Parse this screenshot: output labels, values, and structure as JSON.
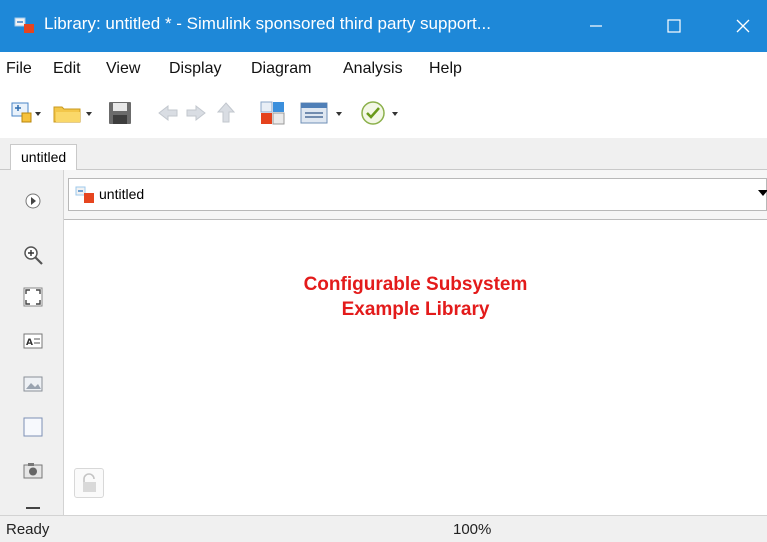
{
  "window": {
    "title": "Library: untitled * - Simulink sponsored third party support...",
    "accent_color": "#1e88d8"
  },
  "menu": [
    "File",
    "Edit",
    "View",
    "Display",
    "Diagram",
    "Analysis",
    "Help"
  ],
  "toolbar": {
    "icons": [
      "new-model-icon",
      "open-folder-icon",
      "save-icon",
      "back-icon",
      "forward-icon",
      "up-icon",
      "library-browser-icon",
      "model-config-icon",
      "check-model-icon"
    ]
  },
  "tabs": [
    {
      "label": "untitled"
    }
  ],
  "address": {
    "model": "untitled"
  },
  "left_toolbar": [
    "hide-show-explorer-icon",
    "zoom-icon",
    "fit-to-view-icon",
    "annotation-icon",
    "image-icon",
    "area-icon",
    "screenshot-icon"
  ],
  "canvas": {
    "title_line1": "Configurable Subsystem",
    "title_line2": "Example Library",
    "title_color": "#e31b1b"
  },
  "status": {
    "text": "Ready",
    "zoom": "100%"
  }
}
